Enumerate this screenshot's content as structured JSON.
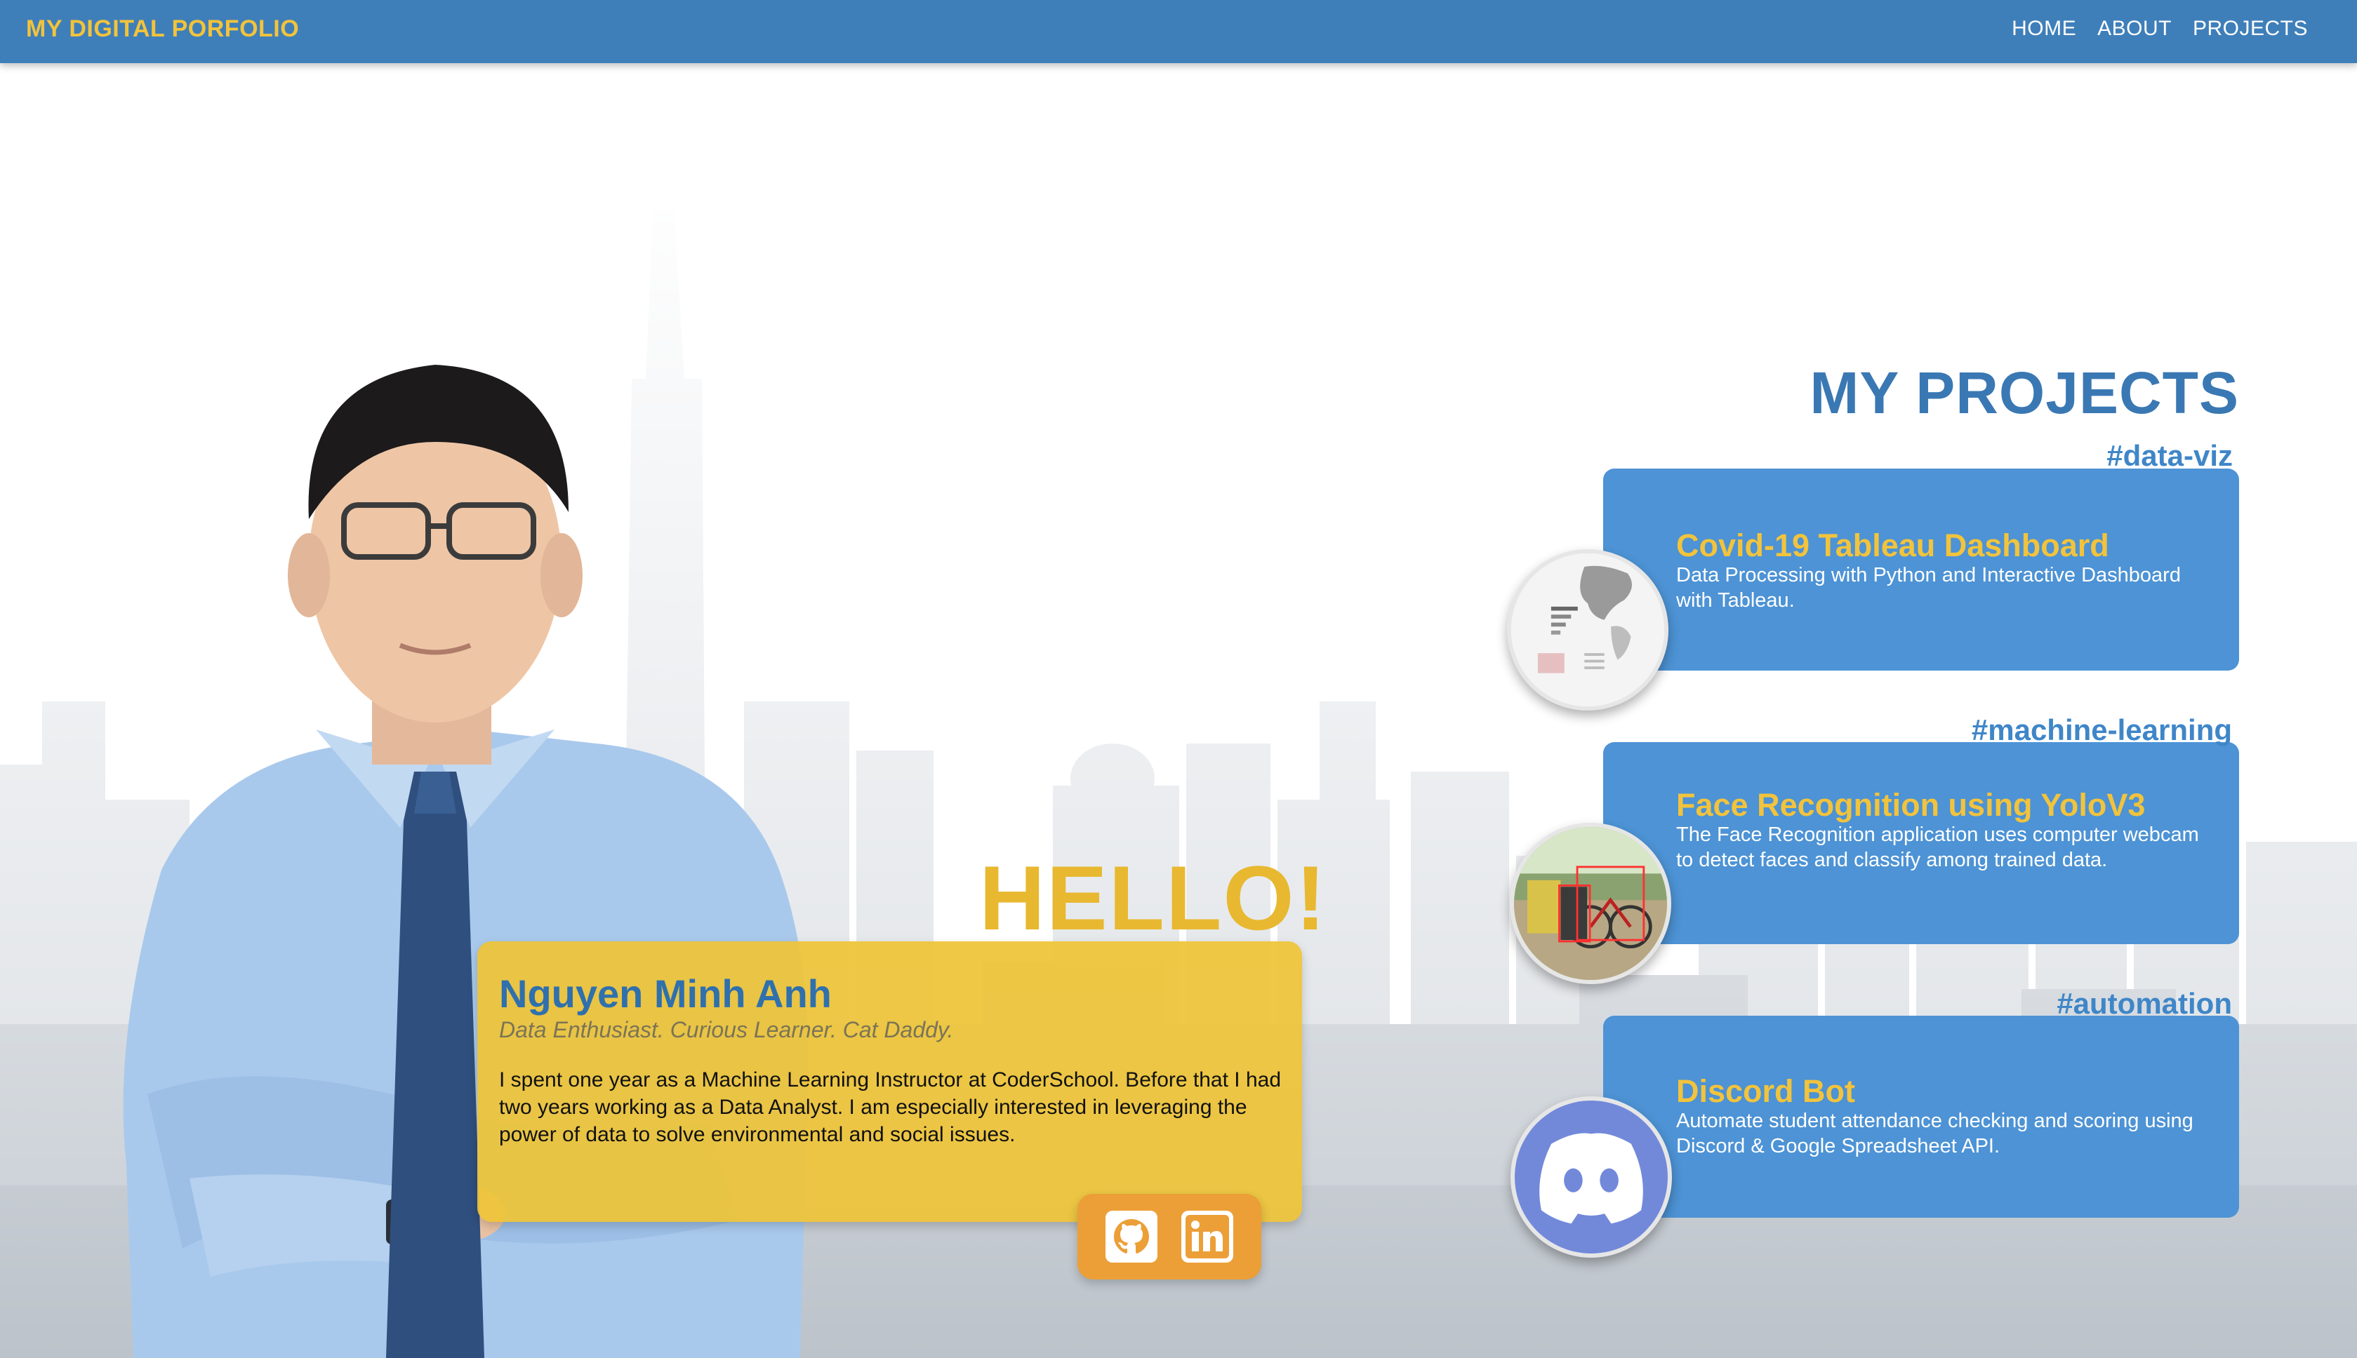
{
  "navbar": {
    "brand": "MY DIGITAL PORFOLIO",
    "links": [
      "HOME",
      "ABOUT",
      "PROJECTS"
    ]
  },
  "intro": {
    "greeting": "HELLO!",
    "name": "Nguyen Minh Anh",
    "tagline": "Data Enthusiast. Curious Learner. Cat Daddy.",
    "bio": "I spent one year as a Machine Learning Instructor at CoderSchool. Before that I had two years working as a Data Analyst. I am especially interested in leveraging the power of data to solve environmental and social issues.",
    "social": [
      {
        "icon": "github-icon"
      },
      {
        "icon": "linkedin-icon"
      }
    ]
  },
  "projects": {
    "title": "MY PROJECTS",
    "items": [
      {
        "tag": "#data-viz",
        "title": "Covid-19 Tableau Dashboard",
        "description": "Data Processing with Python and Interactive Dashboard with Tableau.",
        "thumbnail": "dashboard-thumbnail"
      },
      {
        "tag": "#machine-learning",
        "title": "Face Recognition using YoloV3",
        "description": "The Face Recognition application uses computer webcam to detect faces and classify among trained data.",
        "thumbnail": "face-recognition-thumbnail"
      },
      {
        "tag": "#automation",
        "title": "Discord Bot",
        "description": "Automate student attendance checking and scoring using Discord & Google Spreadsheet API.",
        "thumbnail": "discord-logo-thumbnail"
      }
    ]
  },
  "colors": {
    "navbar": "#3f7fb9",
    "accent_yellow": "#f2c33c",
    "card_blue": "#4d93d5",
    "social_orange": "#ec9f37",
    "title_blue": "#3a78b4"
  }
}
